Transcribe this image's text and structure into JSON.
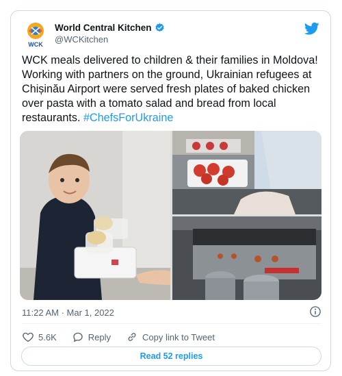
{
  "author": {
    "name": "World Central Kitchen",
    "handle": "@WCKitchen",
    "logo_text": "WCK",
    "verified": true
  },
  "tweet": {
    "text": "WCK meals delivered to children & their families in Moldova! Working with partners on the ground, Ukrainian refugees at Chișinău Airport were served fresh plates of baked chicken over pasta with a tomato salad and bread from local restaurants. ",
    "hashtag": "#ChefsForUkraine",
    "timestamp": "11:22 AM · Mar 1, 2022"
  },
  "actions": {
    "likes": "5.6K",
    "reply_label": "Reply",
    "copy_link_label": "Copy link to Tweet"
  },
  "replies_button_label": "Read 52 replies",
  "colors": {
    "accent": "#1d9bf0",
    "text": "#0f1419",
    "muted": "#536471",
    "border": "#cfd9de"
  },
  "icons": [
    "wck-logo",
    "verified-badge-icon",
    "twitter-bird-icon",
    "info-icon",
    "heart-icon",
    "reply-icon",
    "link-icon"
  ]
}
